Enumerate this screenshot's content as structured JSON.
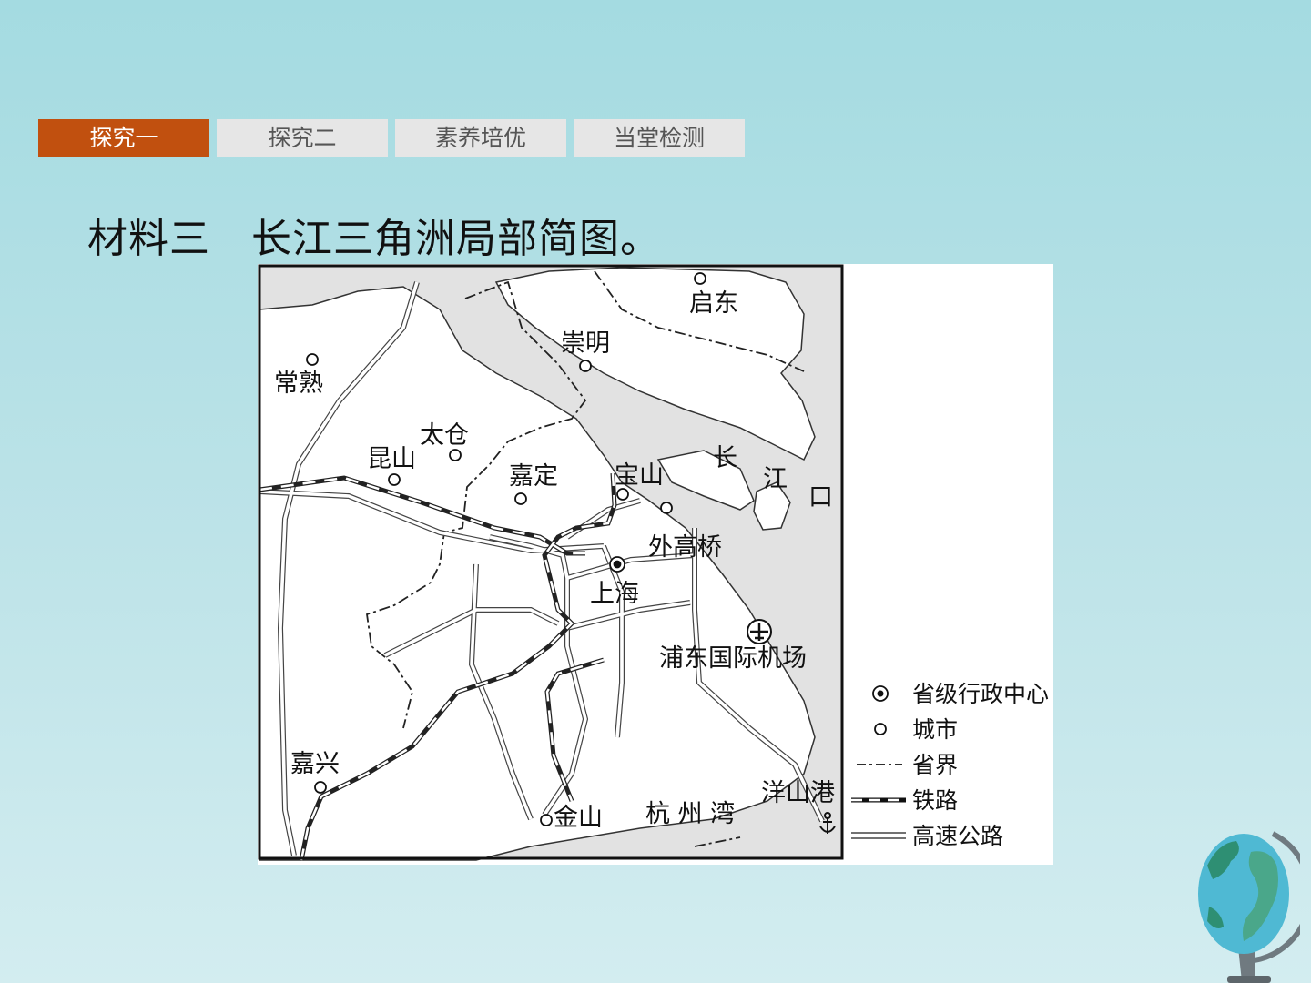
{
  "tabs": [
    {
      "label": "探究一",
      "active": true
    },
    {
      "label": "探究二",
      "active": false
    },
    {
      "label": "素养培优",
      "active": false
    },
    {
      "label": "当堂检测",
      "active": false
    }
  ],
  "title": "材料三　长江三角洲局部简图。",
  "map": {
    "cities": {
      "qidong": "启东",
      "chongming": "崇明",
      "changshu": "常熟",
      "taicang": "太仓",
      "kunshan": "昆山",
      "jiading": "嘉定",
      "baoshan": "宝山",
      "waigaoqiao": "外高桥",
      "shanghai": "上海",
      "jiaxing": "嘉兴",
      "jinshan": "金山",
      "yangshan": "洋山港"
    },
    "places": {
      "airport": "浦东国际机场",
      "river_mouth_1": "长",
      "river_mouth_2": "江",
      "river_mouth_3": "口",
      "bay": "杭 州 湾"
    },
    "legend": {
      "capital": "省级行政中心",
      "city": "城市",
      "border": "省界",
      "railway": "铁路",
      "highway": "高速公路"
    }
  },
  "colors": {
    "tab_active": "#c1500f",
    "tab_inactive": "#e6e6e6",
    "water": "#e2e2e2",
    "background_top": "#a4dbe1"
  },
  "icons": [
    "airplane-icon",
    "anchor-icon",
    "globe-icon"
  ]
}
